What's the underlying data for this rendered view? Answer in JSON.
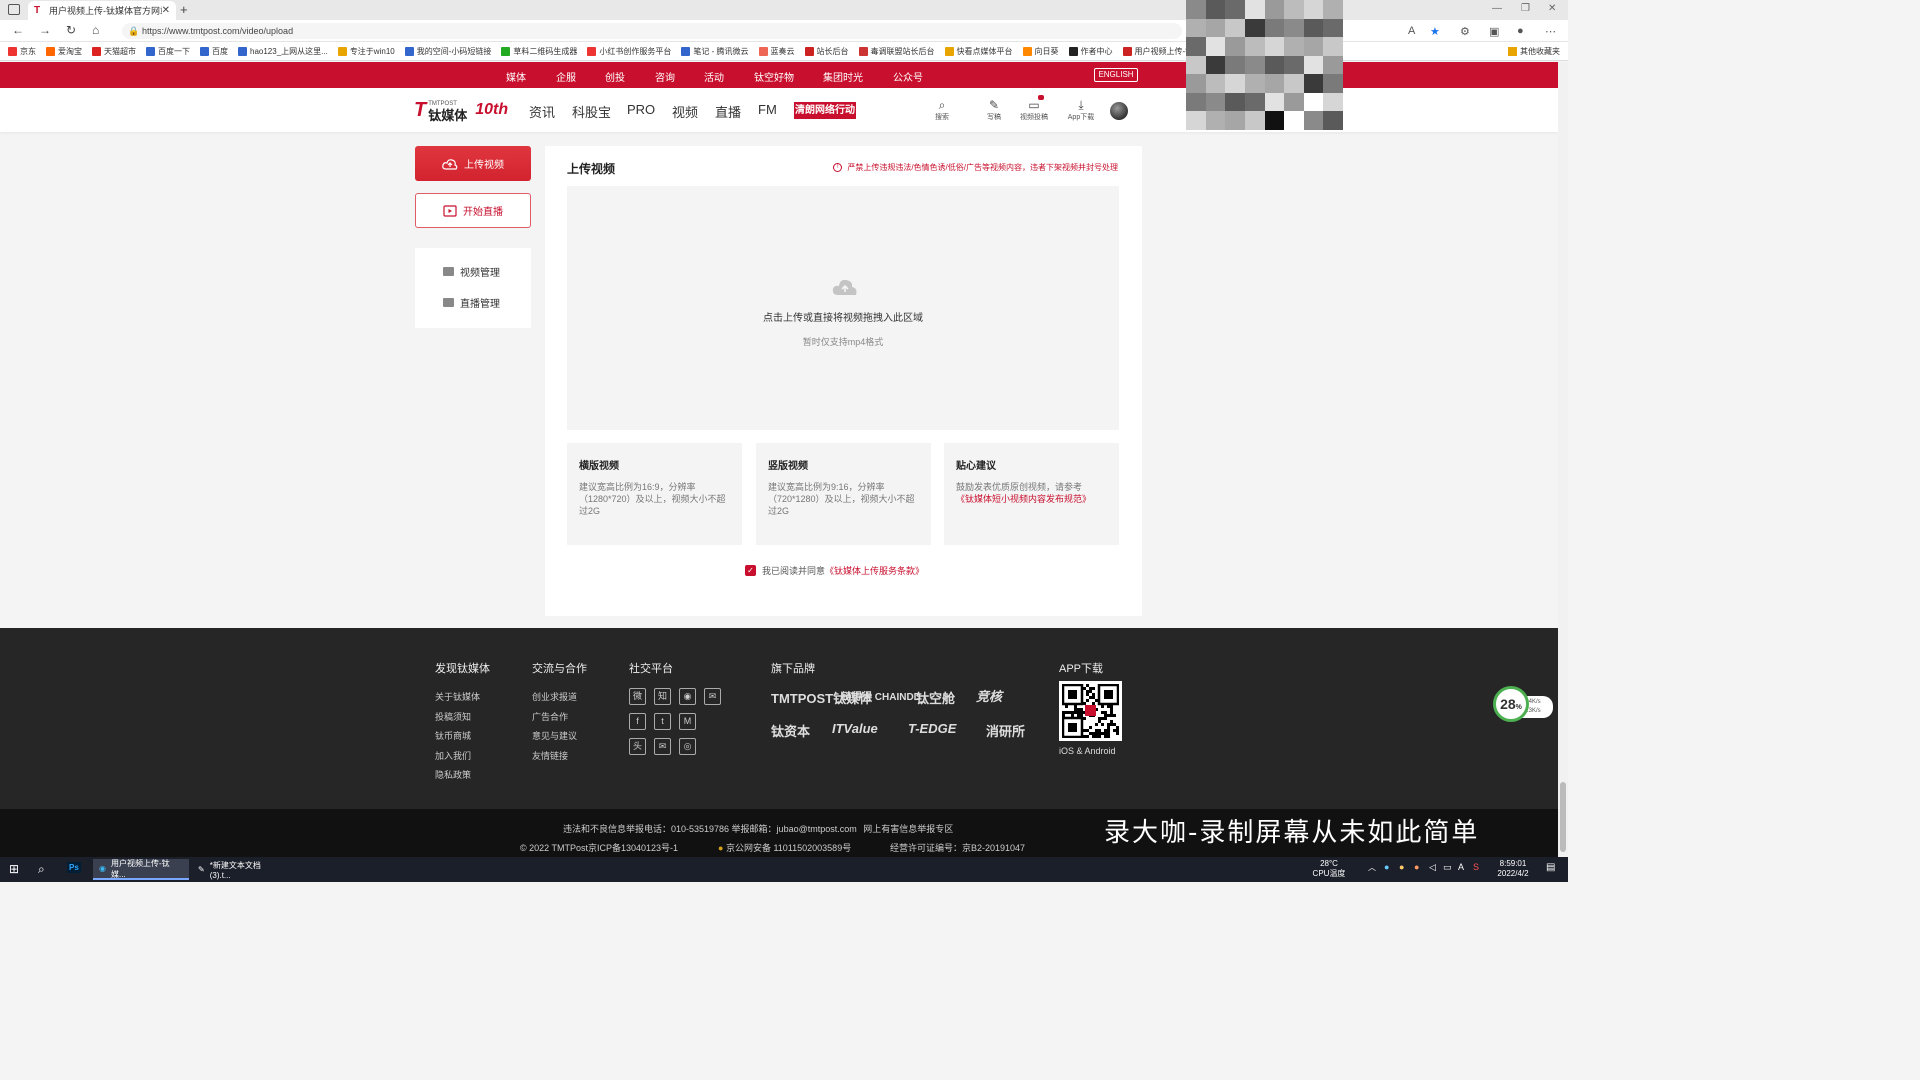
{
  "browser": {
    "tab_title": "用户视频上传-钛媒体官方网站",
    "url": "https://www.tmtpost.com/video/upload",
    "bookmarks": [
      "京东",
      "爱淘宝",
      "天猫超市",
      "百度一下",
      "百度",
      "hao123_上网从这里...",
      "专注于win10",
      "我的空间-小码短链接",
      "草料二维码生成器",
      "小红书创作服务平台",
      "笔记 - 腾讯微云",
      "蓝奏云",
      "站长后台",
      "毒调联盟站长后台",
      "快看点媒体平台",
      "向日葵",
      "作者中心",
      "用户视频上传-钛媒..."
    ],
    "other_bookmarks": "其他收藏夹"
  },
  "site": {
    "top_nav": [
      "媒体",
      "企服",
      "创投",
      "咨询",
      "活动",
      "钛空好物",
      "集团时光",
      "公众号"
    ],
    "english_label": "ENGLISH",
    "logo_brand": "钛媒体",
    "logo_sub": "TMTPOST",
    "logo_anniv": "10th",
    "main_nav": [
      "资讯",
      "科股宝",
      "PRO",
      "视频",
      "直播",
      "FM"
    ],
    "promo_label": "清朗网络行动",
    "tools": {
      "search": "搜索",
      "write": "写稿",
      "video": "视频投稿",
      "app": "App下载"
    }
  },
  "sidebar": {
    "upload_label": "上传视频",
    "live_label": "开始直播",
    "video_manage": "视频管理",
    "live_manage": "直播管理"
  },
  "main": {
    "title": "上传视频",
    "warning": "严禁上传违规违法/色情色诱/低俗/广告等视频内容，违者下架视频并封号处理",
    "drop_text": "点击上传或直接将视频拖拽入此区域",
    "drop_sub": "暂时仅支持mp4格式",
    "tips": [
      {
        "title": "横版视频",
        "desc": "建议宽高比例为16:9，分辨率（1280*720）及以上，视频大小不超过2G"
      },
      {
        "title": "竖版视频",
        "desc": "建议宽高比例为9:16，分辨率（720*1280）及以上，视频大小不超过2G"
      },
      {
        "title": "贴心建议",
        "desc": "鼓励发表优质原创视频，请参考",
        "link": "《钛媒体短小视频内容发布规范》"
      }
    ],
    "agree_text": "我已阅读并同意",
    "agree_link": "《钛媒体上传服务条款》"
  },
  "footer": {
    "col1_title": "发现钛媒体",
    "col1_links": [
      "关于钛媒体",
      "投稿须知",
      "钛币商城",
      "加入我们",
      "隐私政策"
    ],
    "col2_title": "交流与合作",
    "col2_links": [
      "创业求报道",
      "广告合作",
      "意见与建议",
      "友情链接"
    ],
    "col3_title": "社交平台",
    "col4_title": "旗下品牌",
    "brands": [
      "TMTPOST钛媒体",
      "链得得 CHAINDD",
      "钛空舱",
      "竞核",
      "钛资本",
      "ITValue",
      "T-EDGE",
      "消研所"
    ],
    "col5_title": "APP下载",
    "qr_caption": "iOS & Android",
    "report_line": "违法和不良信息举报电话：010-53519786 举报邮箱：jubao@tmtpost.com",
    "report_zone": "网上有害信息举报专区",
    "icp": "© 2022 TMTPost京ICP备13040123号-1",
    "police": "京公网安备 11011502003589号",
    "license": "经营许可证编号：京B2-20191047"
  },
  "overlay": {
    "watermark": "录大咖-录制屏幕从未如此简单",
    "speed_value": "28",
    "speed_unit": "%",
    "up_speed": "0.4K/s",
    "down_speed": "0.3K/s"
  },
  "taskbar": {
    "app1": "用户视频上传-钛媒...",
    "app2": "*新建文本文档 (3).t...",
    "temp": "28°C",
    "temp_label": "CPU温度",
    "time": "8:59:01",
    "date": "2022/4/2"
  },
  "colors": {
    "brand_red": "#c8102e",
    "footer_bg": "#262626"
  }
}
